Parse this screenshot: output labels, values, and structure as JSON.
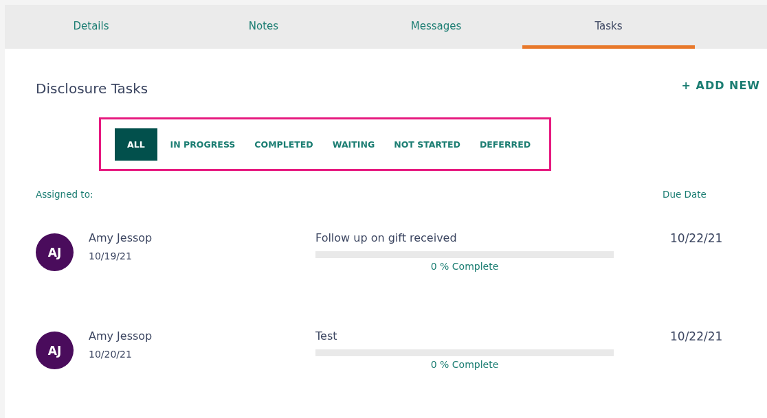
{
  "tabs": [
    {
      "label": "Details",
      "selected": false
    },
    {
      "label": "Notes",
      "selected": false
    },
    {
      "label": "Messages",
      "selected": false
    },
    {
      "label": "Tasks",
      "selected": true
    }
  ],
  "section": {
    "title": "Disclosure Tasks",
    "add_button": "+ ADD NEW"
  },
  "filters": [
    {
      "label": "ALL",
      "selected": true
    },
    {
      "label": "IN PROGRESS",
      "selected": false
    },
    {
      "label": "COMPLETED",
      "selected": false
    },
    {
      "label": "WAITING",
      "selected": false
    },
    {
      "label": "NOT STARTED",
      "selected": false
    },
    {
      "label": "DEFERRED",
      "selected": false
    }
  ],
  "columns": {
    "assigned": "Assigned to:",
    "due": "Due Date"
  },
  "tasks": [
    {
      "initials": "AJ",
      "name": "Amy Jessop",
      "assigned_date": "10/19/21",
      "title": "Follow up on gift received",
      "level": 0,
      "progress_text": "0 % Complete",
      "due": "10/22/21"
    },
    {
      "initials": "AJ",
      "name": "Amy Jessop",
      "assigned_date": "10/20/21",
      "title": "Test",
      "level": 0,
      "progress_text": "0 % Complete",
      "due": "10/22/21"
    }
  ]
}
